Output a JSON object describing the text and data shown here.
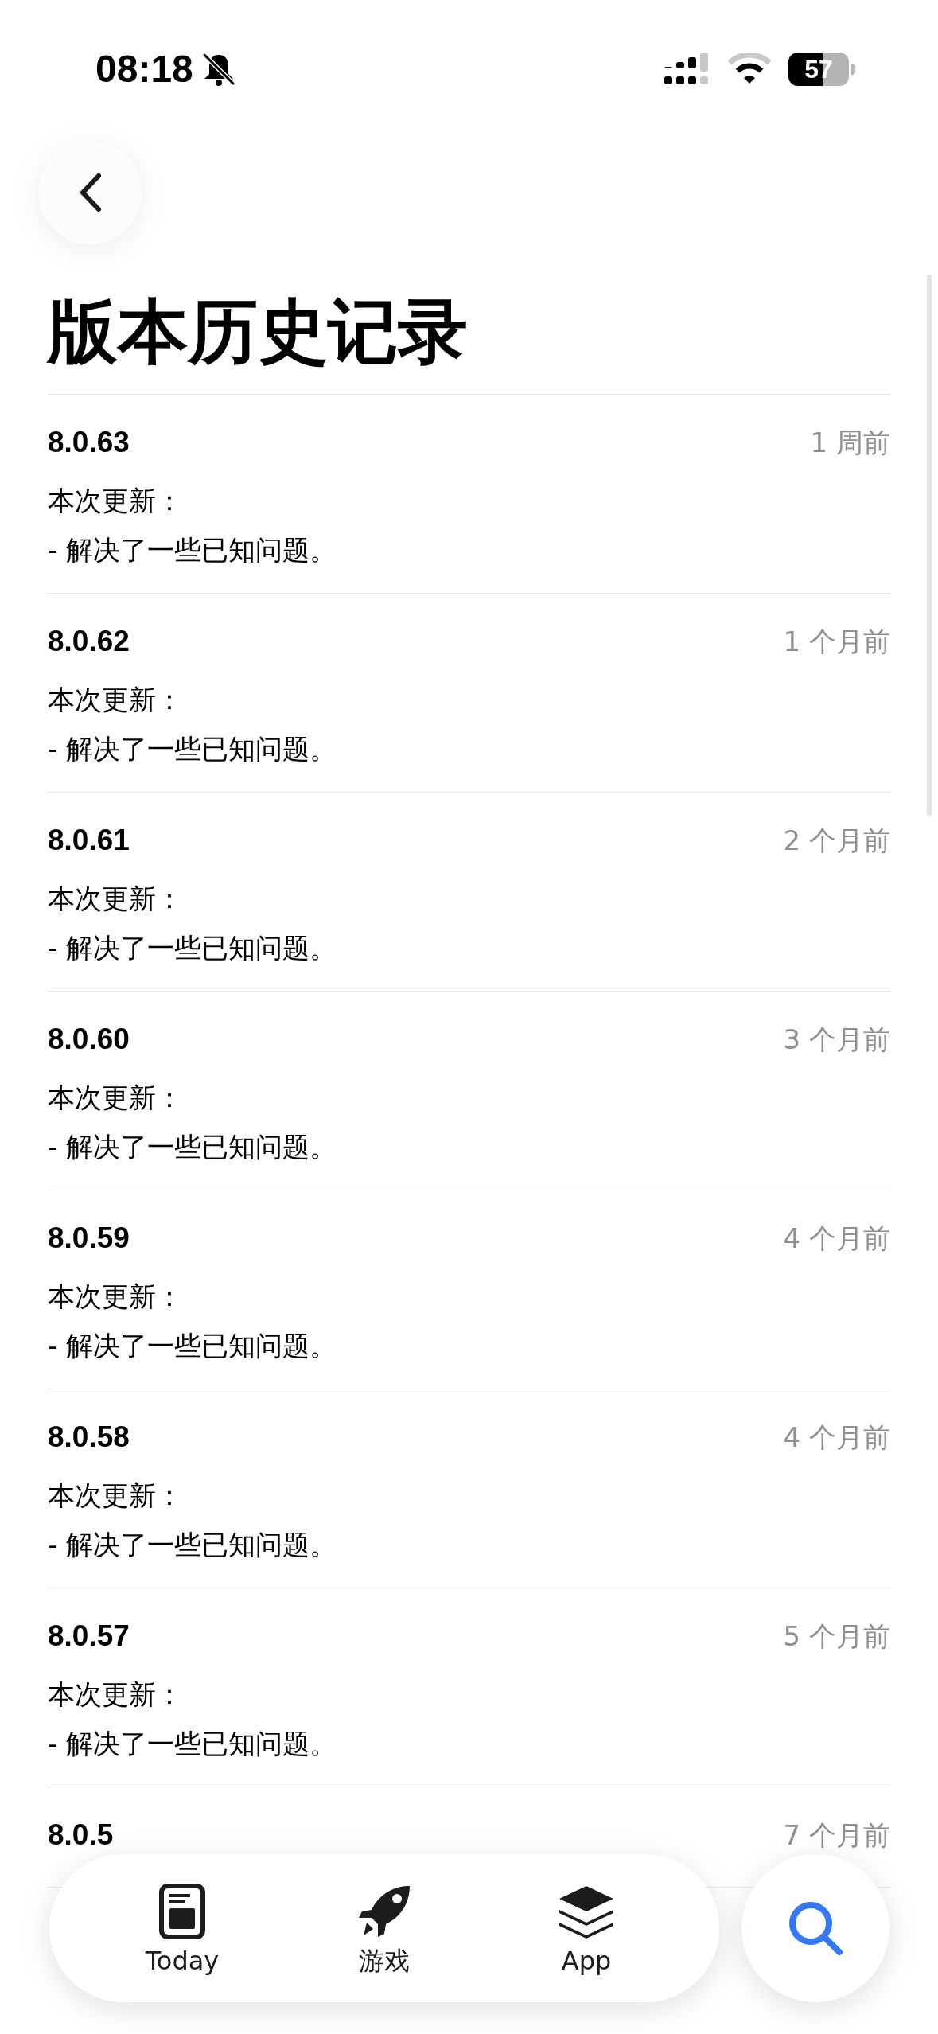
{
  "status_bar": {
    "time": "08:18",
    "battery": "57"
  },
  "page": {
    "title": "版本历史记录"
  },
  "versions": [
    {
      "version": "8.0.63",
      "date": "1 周前",
      "notes": [
        "本次更新：",
        "- 解决了一些已知问题。"
      ]
    },
    {
      "version": "8.0.62",
      "date": "1 个月前",
      "notes": [
        "本次更新：",
        "- 解决了一些已知问题。"
      ]
    },
    {
      "version": "8.0.61",
      "date": "2 个月前",
      "notes": [
        "本次更新：",
        "- 解决了一些已知问题。"
      ]
    },
    {
      "version": "8.0.60",
      "date": "3 个月前",
      "notes": [
        "本次更新：",
        "- 解决了一些已知问题。"
      ]
    },
    {
      "version": "8.0.59",
      "date": "4 个月前",
      "notes": [
        "本次更新：",
        "- 解决了一些已知问题。"
      ]
    },
    {
      "version": "8.0.58",
      "date": "4 个月前",
      "notes": [
        "本次更新：",
        "- 解决了一些已知问题。"
      ]
    },
    {
      "version": "8.0.57",
      "date": "5 个月前",
      "notes": [
        "本次更新：",
        "- 解决了一些已知问题。"
      ]
    },
    {
      "version": "8.0.5",
      "date": "7 个月前"
    }
  ],
  "tab_bar": {
    "tabs": [
      {
        "label": "Today",
        "kind": "today",
        "selected": false
      },
      {
        "label": "游戏",
        "kind": "games",
        "selected": false
      },
      {
        "label": "App",
        "kind": "apps",
        "selected": false
      }
    ],
    "search": {
      "selected": true
    }
  }
}
